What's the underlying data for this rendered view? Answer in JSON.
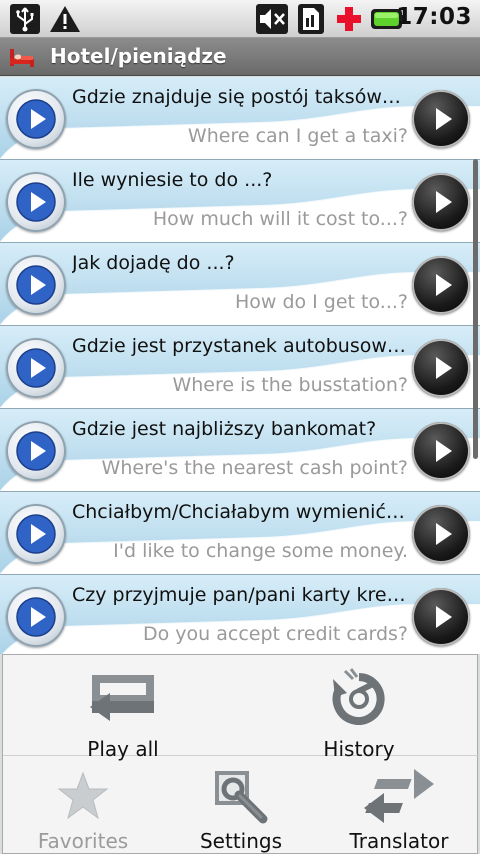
{
  "status_bar": {
    "time": "17:03",
    "icons": [
      "usb-icon",
      "warning-icon",
      "mute-icon",
      "sim-icon",
      "medical-cross-icon",
      "battery-icon"
    ]
  },
  "title_bar": {
    "icon": "hotel-bed-icon",
    "title": "Hotel/pieniądze"
  },
  "phrases": [
    {
      "polish": "Gdzie znajduje się postój taksówek?",
      "english": "Where can I get a taxi?"
    },
    {
      "polish": "Ile wyniesie to do ...?",
      "english": "How much will it cost to...?"
    },
    {
      "polish": "Jak dojadę do ...?",
      "english": "How do I get to...?"
    },
    {
      "polish": "Gdzie jest przystanek autobusowy?",
      "english": "Where is the busstation?"
    },
    {
      "polish": "Gdzie jest najbliższy bankomat?",
      "english": "Where's the nearest cash point?"
    },
    {
      "polish": "Chciałbym/Chciałabym wymienić ...",
      "english": "I'd like to change some money."
    },
    {
      "polish": "Czy przyjmuje pan/pani karty kred...",
      "english": "Do you accept credit cards?"
    }
  ],
  "menu": {
    "play_all": "Play all",
    "history": "History",
    "favorites": "Favorites",
    "settings": "Settings",
    "translator": "Translator"
  },
  "colors": {
    "row_accent": "#bfe0f2",
    "menu_background": "#f4f4f4",
    "title_bar": "#7a7a7a"
  }
}
